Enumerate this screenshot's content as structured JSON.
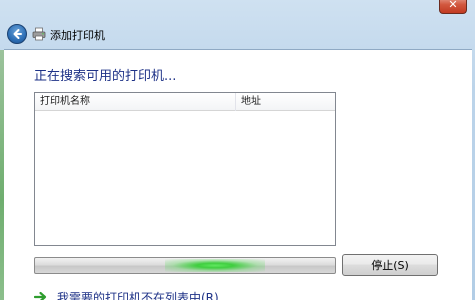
{
  "window": {
    "title": "添加打印机",
    "close_glyph": "✕"
  },
  "main": {
    "heading": "正在搜索可用的打印机...",
    "columns": [
      "打印机名称",
      "地址"
    ],
    "progress": {
      "indeterminate": true,
      "glow_center_fraction": 0.6
    },
    "stop_label": "停止(S)",
    "not_listed_link": "我需要的打印机不在列表中(R)"
  },
  "icons": {
    "back": "back-arrow-icon",
    "printer": "printer-icon",
    "link_arrow": "green-arrow-icon"
  },
  "colors": {
    "heading_text": "#1e3287",
    "progress_glow": "#3fce3f",
    "link_arrow": "#2e9d2e"
  }
}
